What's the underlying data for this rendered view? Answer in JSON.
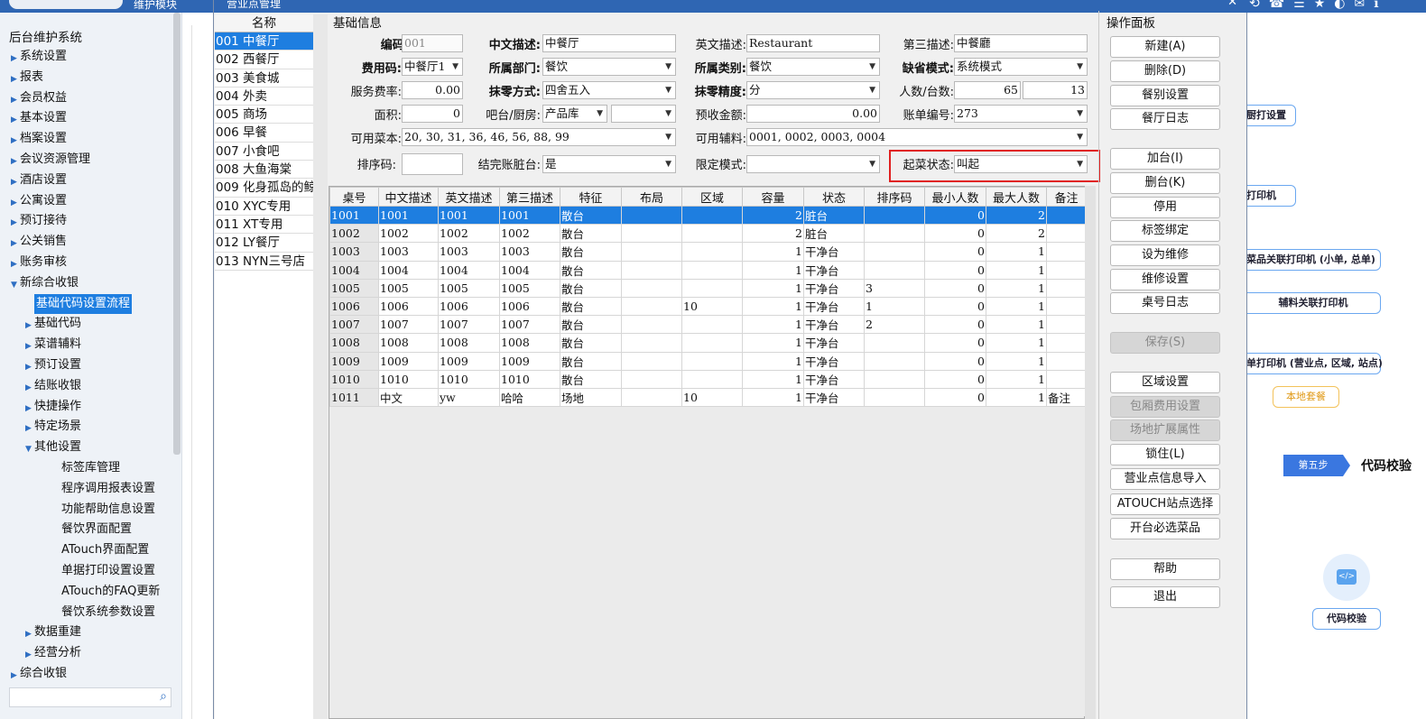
{
  "window_title": "营业点管理",
  "top_label": "维护模块",
  "sidebar": {
    "title": "后台维护系统",
    "items": [
      {
        "label": "系统设置",
        "level": 1,
        "arrow": "▶"
      },
      {
        "label": "报表",
        "level": 1,
        "arrow": "▶"
      },
      {
        "label": "会员权益",
        "level": 1,
        "arrow": "▶"
      },
      {
        "label": "基本设置",
        "level": 1,
        "arrow": "▶"
      },
      {
        "label": "档案设置",
        "level": 1,
        "arrow": "▶"
      },
      {
        "label": "会议资源管理",
        "level": 1,
        "arrow": "▶"
      },
      {
        "label": "酒店设置",
        "level": 1,
        "arrow": "▶"
      },
      {
        "label": "公寓设置",
        "level": 1,
        "arrow": "▶"
      },
      {
        "label": "预订接待",
        "level": 1,
        "arrow": "▶"
      },
      {
        "label": "公关销售",
        "level": 1,
        "arrow": "▶"
      },
      {
        "label": "账务审核",
        "level": 1,
        "arrow": "▶"
      },
      {
        "label": "新综合收银",
        "level": 1,
        "arrow": "▼"
      },
      {
        "label": "基础代码设置流程",
        "level": 2,
        "arrow": "",
        "selected": true
      },
      {
        "label": "基础代码",
        "level": 2,
        "arrow": "▶"
      },
      {
        "label": "菜谱辅料",
        "level": 2,
        "arrow": "▶"
      },
      {
        "label": "预订设置",
        "level": 2,
        "arrow": "▶"
      },
      {
        "label": "结账收银",
        "level": 2,
        "arrow": "▶"
      },
      {
        "label": "快捷操作",
        "level": 2,
        "arrow": "▶"
      },
      {
        "label": "特定场景",
        "level": 2,
        "arrow": "▶"
      },
      {
        "label": "其他设置",
        "level": 2,
        "arrow": "▼"
      },
      {
        "label": "标签库管理",
        "level": 3,
        "arrow": ""
      },
      {
        "label": "程序调用报表设置",
        "level": 3,
        "arrow": ""
      },
      {
        "label": "功能帮助信息设置",
        "level": 3,
        "arrow": ""
      },
      {
        "label": "餐饮界面配置",
        "level": 3,
        "arrow": ""
      },
      {
        "label": "ATouch界面配置",
        "level": 3,
        "arrow": ""
      },
      {
        "label": "单据打印设置设置",
        "level": 3,
        "arrow": ""
      },
      {
        "label": "ATouch的FAQ更新",
        "level": 3,
        "arrow": ""
      },
      {
        "label": "餐饮系统参数设置",
        "level": 3,
        "arrow": ""
      },
      {
        "label": "数据重建",
        "level": 2,
        "arrow": "▶"
      },
      {
        "label": "经营分析",
        "level": 2,
        "arrow": "▶"
      },
      {
        "label": "综合收银",
        "level": 1,
        "arrow": "▶"
      }
    ]
  },
  "name_list": {
    "header": "名称",
    "rows": [
      "001 中餐厅",
      "002 西餐厅",
      "003 美食城",
      "004 外卖",
      "005 商场",
      "006 早餐",
      "007 小食吧",
      "008 大鱼海棠",
      "009 化身孤岛的鲸",
      "010 XYC专用",
      "011 XT专用",
      "012 LY餐厅",
      "013 NYN三号店"
    ]
  },
  "form": {
    "group_title": "基础信息",
    "code_label": "编码:",
    "code_value": "001",
    "cn_desc_label": "中文描述:",
    "cn_desc_value": "中餐厅",
    "en_desc_label": "英文描述:",
    "en_desc_value": "Restaurant",
    "third_desc_label": "第三描述:",
    "third_desc_value": "中餐廳",
    "fee_code_label": "费用码:",
    "fee_code_value": "中餐厅1",
    "dept_label": "所属部门:",
    "dept_value": "餐饮",
    "category_label": "所属类别:",
    "category_value": "餐饮",
    "default_mode_label": "缺省模式:",
    "default_mode_value": "系统模式",
    "service_rate_label": "服务费率:",
    "service_rate_value": "0.00",
    "rounding_label": "抹零方式:",
    "rounding_value": "四舍五入",
    "rounding_precision_label": "抹零精度:",
    "rounding_precision_value": "分",
    "people_tables_label": "人数/台数:",
    "people_value": "65",
    "tables_value": "13",
    "area_label": "面积:",
    "area_value": "0",
    "bar_kitchen_label": "吧台/厨房:",
    "bar_kitchen_value": "产品库",
    "bar_kitchen_value2": "",
    "prepaid_label": "预收金额:",
    "prepaid_value": "0.00",
    "bill_no_label": "账单编号:",
    "bill_no_value": "273",
    "menus_label": "可用菜本:",
    "menus_value": "20, 30, 31, 36, 46, 56, 88, 99",
    "aux_label": "可用辅料:",
    "aux_value": "0001, 0002, 0003, 0004",
    "sort_label": "排序码:",
    "sort_value": "",
    "dirty_label": "结完账脏台:",
    "dirty_value": "是",
    "limit_mode_label": "限定模式:",
    "limit_mode_value": "",
    "serve_status_label": "起菜状态:",
    "serve_status_value": "叫起"
  },
  "table": {
    "columns": [
      "桌号",
      "中文描述",
      "英文描述",
      "第三描述",
      "特征",
      "布局",
      "区域",
      "容量",
      "状态",
      "排序码",
      "最小人数",
      "最大人数",
      "备注"
    ],
    "rows": [
      [
        "1001",
        "1001",
        "1001",
        "1001",
        "散台",
        "",
        "",
        "2",
        "脏台",
        "",
        "0",
        "2",
        ""
      ],
      [
        "1002",
        "1002",
        "1002",
        "1002",
        "散台",
        "",
        "",
        "2",
        "脏台",
        "",
        "0",
        "2",
        ""
      ],
      [
        "1003",
        "1003",
        "1003",
        "1003",
        "散台",
        "",
        "",
        "1",
        "干净台",
        "",
        "0",
        "1",
        ""
      ],
      [
        "1004",
        "1004",
        "1004",
        "1004",
        "散台",
        "",
        "",
        "1",
        "干净台",
        "",
        "0",
        "1",
        ""
      ],
      [
        "1005",
        "1005",
        "1005",
        "1005",
        "散台",
        "",
        "",
        "1",
        "干净台",
        "3",
        "0",
        "1",
        ""
      ],
      [
        "1006",
        "1006",
        "1006",
        "1006",
        "散台",
        "",
        "10",
        "1",
        "干净台",
        "1",
        "0",
        "1",
        ""
      ],
      [
        "1007",
        "1007",
        "1007",
        "1007",
        "散台",
        "",
        "",
        "1",
        "干净台",
        "2",
        "0",
        "1",
        ""
      ],
      [
        "1008",
        "1008",
        "1008",
        "1008",
        "散台",
        "",
        "",
        "1",
        "干净台",
        "",
        "0",
        "1",
        ""
      ],
      [
        "1009",
        "1009",
        "1009",
        "1009",
        "散台",
        "",
        "",
        "1",
        "干净台",
        "",
        "0",
        "1",
        ""
      ],
      [
        "1010",
        "1010",
        "1010",
        "1010",
        "散台",
        "",
        "",
        "1",
        "干净台",
        "",
        "0",
        "1",
        ""
      ],
      [
        "1011",
        "中文",
        "yw",
        "哈哈",
        "场地",
        "",
        "10",
        "1",
        "干净台",
        "",
        "0",
        "1",
        "备注"
      ]
    ]
  },
  "ops": {
    "title": "操作面板",
    "buttons": [
      {
        "label": "新建(A)",
        "enabled": true
      },
      {
        "label": "删除(D)",
        "enabled": true
      },
      {
        "label": "餐别设置",
        "enabled": true
      },
      {
        "label": "餐厅日志",
        "enabled": true
      },
      {
        "label": "加台(I)",
        "enabled": true
      },
      {
        "label": "删台(K)",
        "enabled": true
      },
      {
        "label": "停用",
        "enabled": true
      },
      {
        "label": "标签绑定",
        "enabled": true
      },
      {
        "label": "设为维修",
        "enabled": true
      },
      {
        "label": "维修设置",
        "enabled": true
      },
      {
        "label": "桌号日志",
        "enabled": true
      },
      {
        "label": "保存(S)",
        "enabled": false
      },
      {
        "label": "区域设置",
        "enabled": true
      },
      {
        "label": "包厢费用设置",
        "enabled": false
      },
      {
        "label": "场地扩展属性",
        "enabled": false
      },
      {
        "label": "锁住(L)",
        "enabled": true
      },
      {
        "label": "营业点信息导入",
        "enabled": true
      },
      {
        "label": "ATOUCH站点选择",
        "enabled": true
      },
      {
        "label": "开台必选菜品",
        "enabled": true
      },
      {
        "label": "帮助",
        "enabled": true
      },
      {
        "label": "退出",
        "enabled": true
      }
    ]
  },
  "background_flow": {
    "box1": "厨打设置",
    "box2": "打印机",
    "box3": "菜品关联打印机 (小单, 总单)",
    "box4": "辅料关联打印机",
    "box5": "单打印机 (营业点, 区域, 站点)",
    "box6": "本地套餐",
    "step_label": "第五步",
    "step_title": "代码校验",
    "code_check": "代码校验",
    "code_icon_text": "</>"
  },
  "colors": {
    "selection": "#1e7ee0",
    "titlebar": "#2f66b3",
    "highlight": "#e02020"
  }
}
